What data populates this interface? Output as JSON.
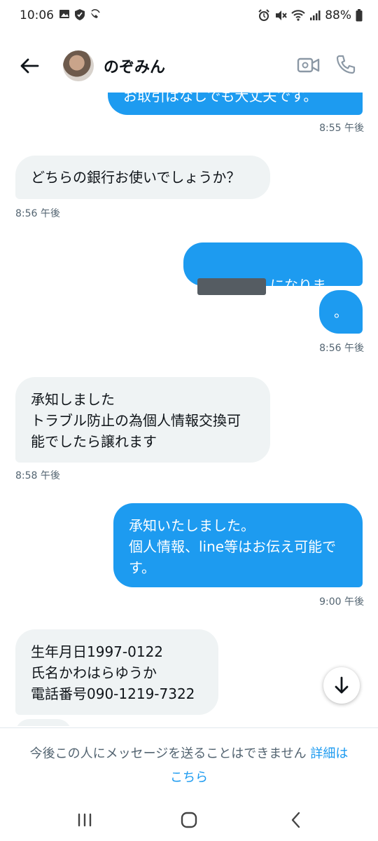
{
  "status_bar": {
    "time": "10:06",
    "battery": "88%",
    "left_icons": [
      "image-icon",
      "shield-icon",
      "wifi-call-icon"
    ],
    "right_icons": [
      "alarm-icon",
      "mute-icon",
      "wifi-icon",
      "signal-icon",
      "battery-icon"
    ]
  },
  "header": {
    "contact_name": "のぞみん",
    "back_icon": "arrow-left-icon",
    "video_icon": "video-call-icon",
    "call_icon": "phone-icon"
  },
  "messages": [
    {
      "dir": "out",
      "text": "お取引はなしでも大丈夫です。",
      "time": "8:55 午後"
    },
    {
      "dir": "in",
      "text": "どちらの銀行お使いでしょうか？",
      "time": "8:56 午後"
    },
    {
      "dir": "out",
      "text": "になります？",
      "redacted": true
    },
    {
      "dir": "out",
      "text": "。",
      "time": "8:56 午後"
    },
    {
      "dir": "in",
      "text": "承知しました\nトラブル防止の為個人情報交換可\n能でしたら譲れます",
      "time": "8:58 午後"
    },
    {
      "dir": "out",
      "text": "承知いたしました。\n個人情報、line等はお伝え可能で\nす。",
      "time": "9:00 午後"
    },
    {
      "dir": "in",
      "text": "生年月日1997-0122\n氏名かわはらゆうか\n電話番号090-1219-7322"
    }
  ],
  "notice": {
    "text": "今後この人にメッセージを送ることはできません",
    "link": "詳細は\nこちら"
  },
  "colors": {
    "accent": "#1d9bf0",
    "incoming_bubble": "#eff3f4",
    "timestamp": "#536471"
  }
}
